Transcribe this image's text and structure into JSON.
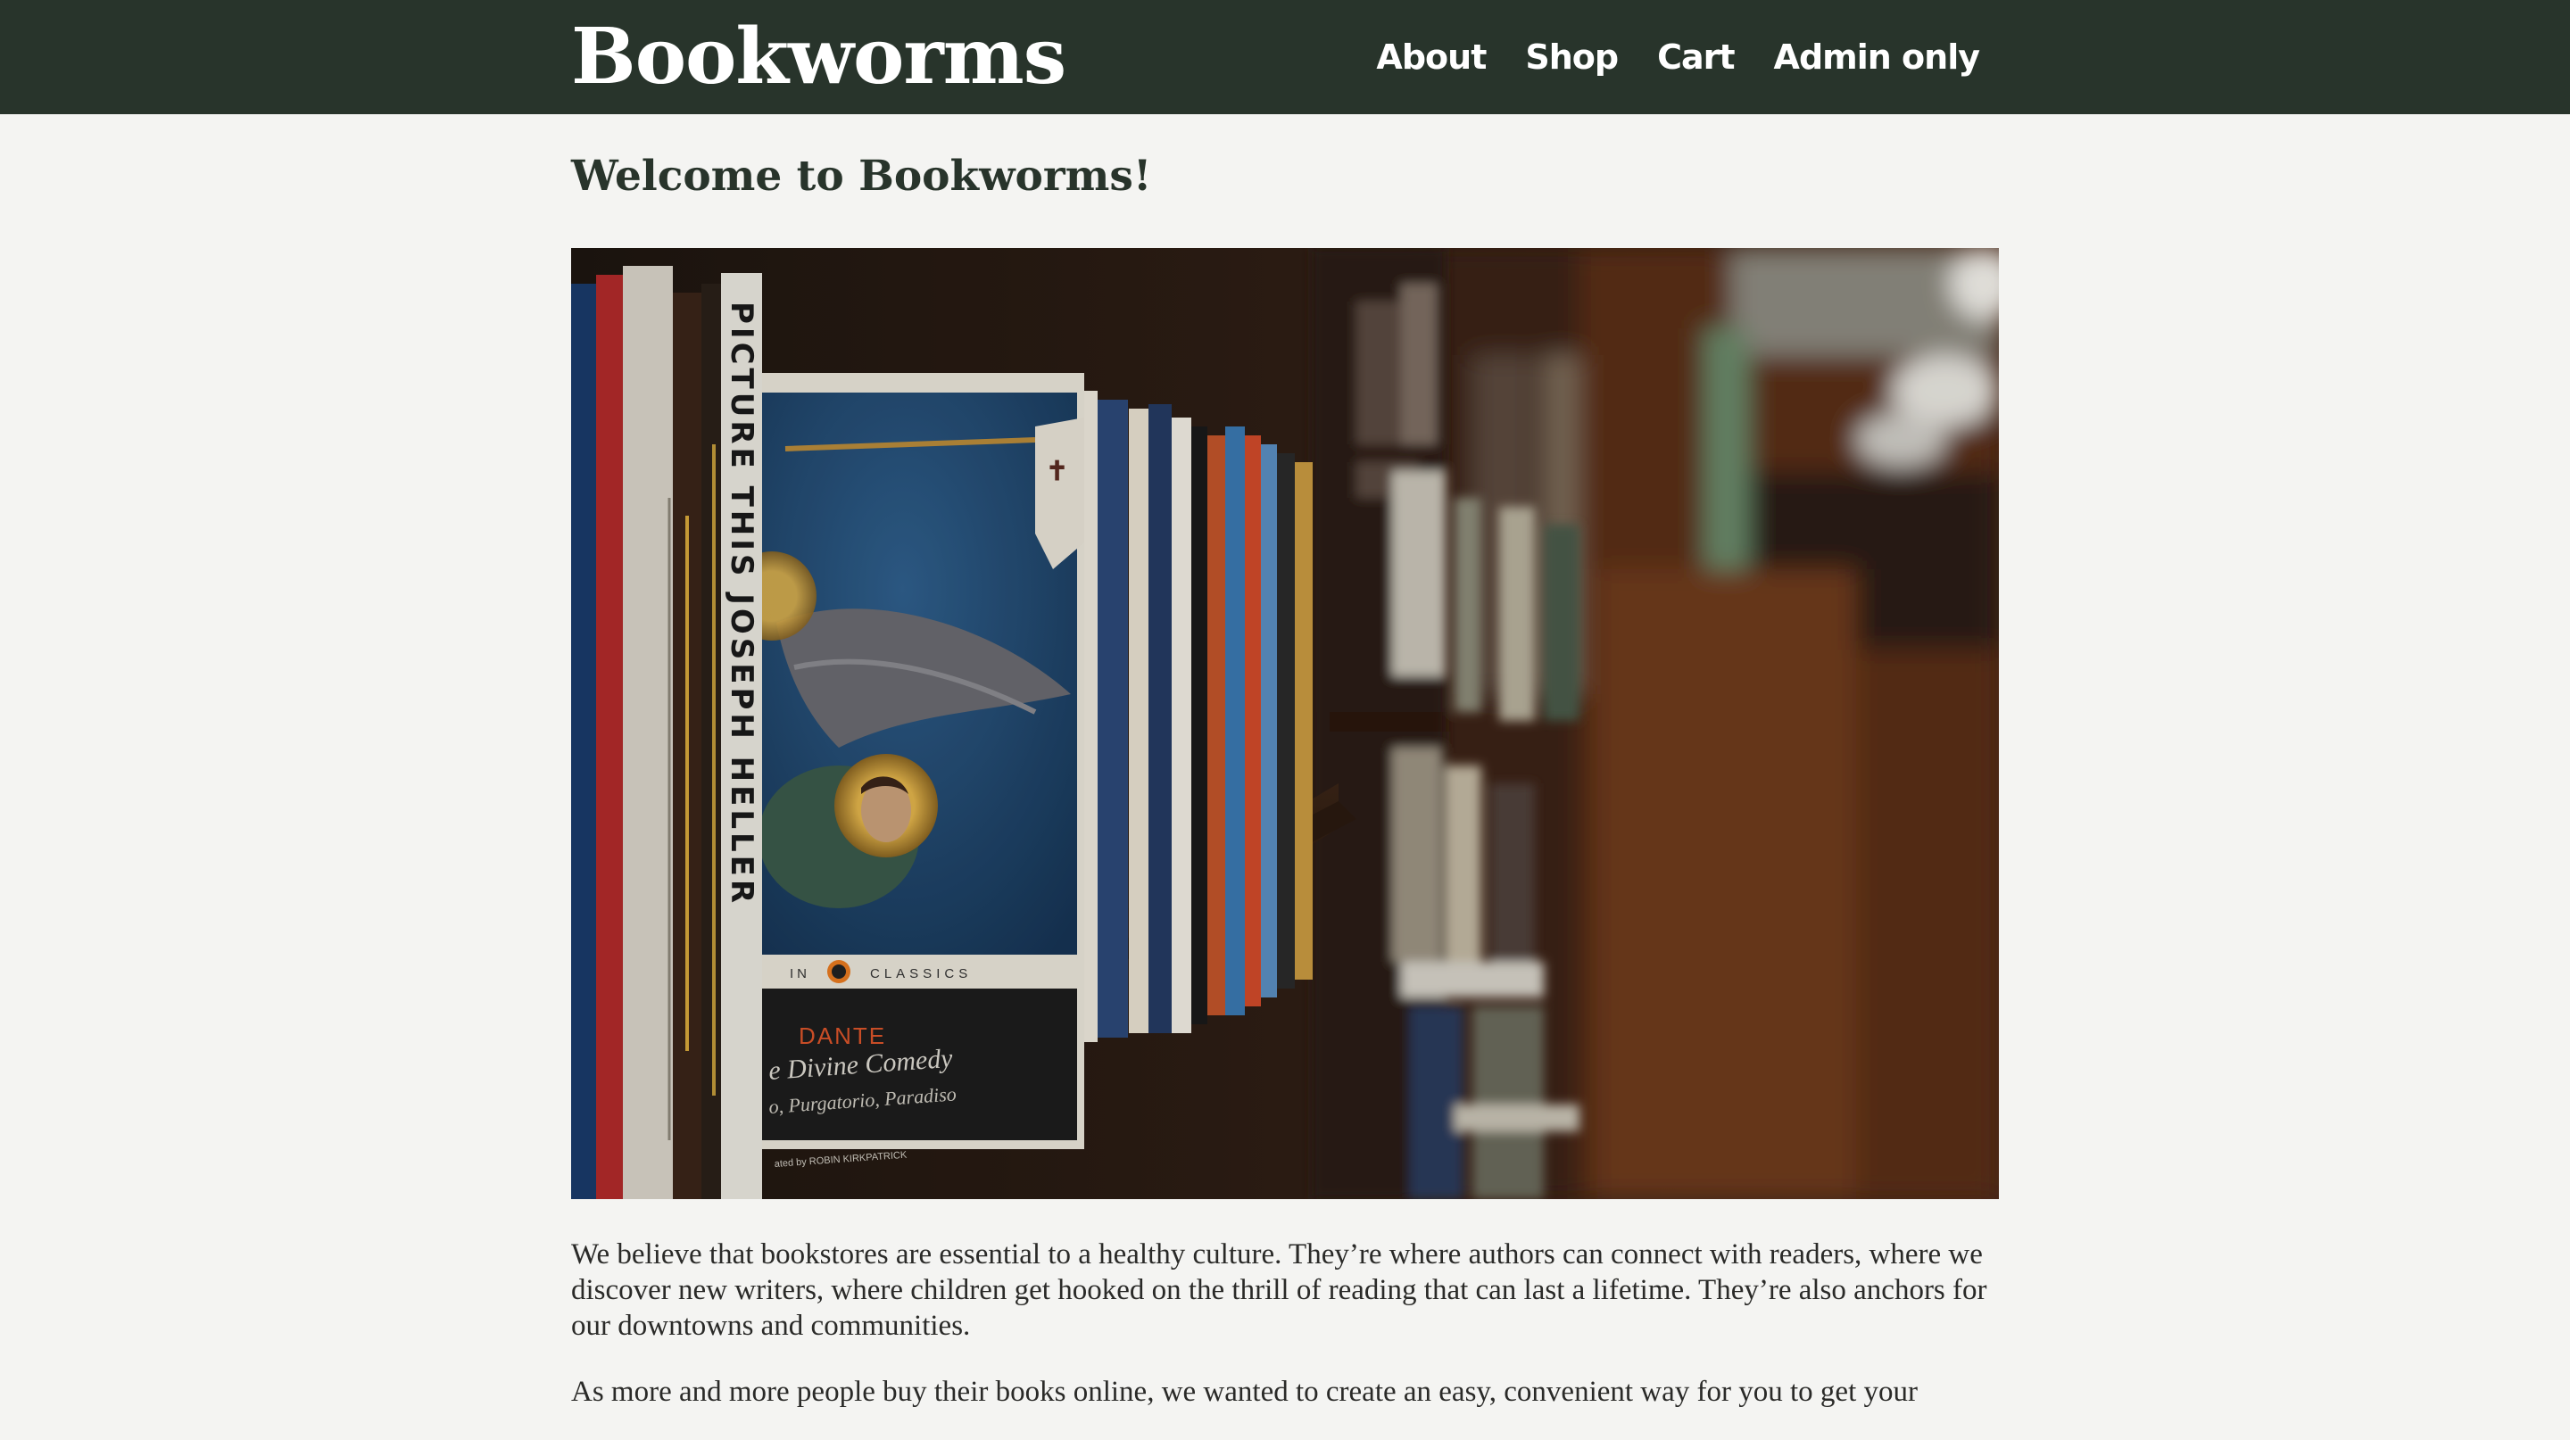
{
  "header": {
    "brand": "Bookworms",
    "nav": [
      {
        "label": "About"
      },
      {
        "label": "Shop"
      },
      {
        "label": "Cart"
      },
      {
        "label": "Admin only"
      }
    ]
  },
  "main": {
    "heading": "Welcome to Bookworms!",
    "hero_image": {
      "spine_text": "PICTURE THIS  JOSEPH HELLER",
      "cover_series": "CLASSICS",
      "cover_author": "DANTE",
      "cover_title": "e Divine Comedy",
      "cover_subtitle": "o, Purgatorio, Paradiso",
      "cover_translator": "ated by ROBIN KIRKPATRICK"
    },
    "paragraphs": [
      "We believe that bookstores are essential to a healthy culture. They’re where authors can connect with readers, where we discover new writers, where children get hooked on the thrill of reading that can last a lifetime. They’re also anchors for our downtowns and communities.",
      "As more and more people buy their books online, we wanted to create an easy, convenient way for you to get your"
    ]
  },
  "colors": {
    "header_bg": "#28342b",
    "page_bg": "#f4f4f2",
    "heading": "#28342b",
    "body_text": "#2a2a28"
  }
}
